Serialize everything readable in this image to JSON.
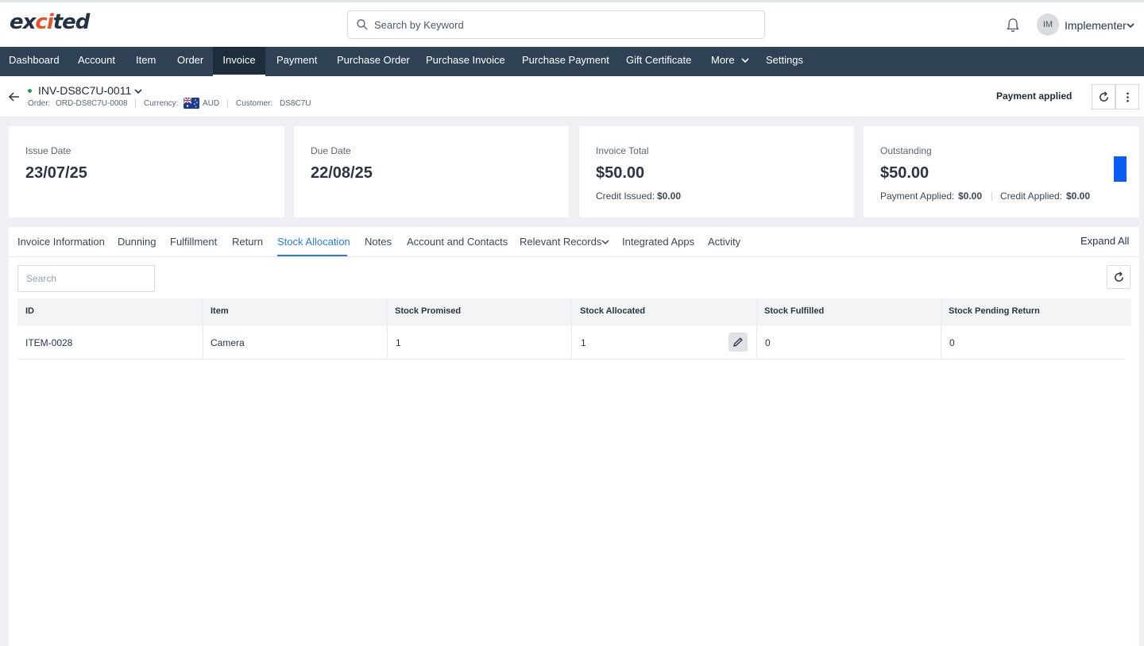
{
  "app": {
    "logo_prefix": "ex",
    "logo_accent": "ci",
    "logo_suffix": "ted"
  },
  "search": {
    "placeholder": "Search by Keyword"
  },
  "user": {
    "initials": "IM",
    "name": "Implementer"
  },
  "nav": {
    "items": [
      "Dashboard",
      "Account",
      "Item",
      "Order",
      "Invoice",
      "Payment",
      "Purchase Order",
      "Purchase Invoice",
      "Purchase Payment",
      "Gift Certificate",
      "More",
      "Settings"
    ],
    "active": "Invoice"
  },
  "record": {
    "id": "INV-DS8C7U-0011",
    "order_label": "Order:",
    "order_value": "ORD-DS8C7U-0008",
    "currency_label": "Currency:",
    "currency_value": "AUD",
    "customer_label": "Customer:",
    "customer_value": "DS8C7U",
    "status": "Payment applied"
  },
  "cards": {
    "issue": {
      "label": "Issue Date",
      "value": "23/07/25"
    },
    "due": {
      "label": "Due Date",
      "value": "22/08/25"
    },
    "total": {
      "label": "Invoice Total",
      "value": "$50.00",
      "credit_issued_label": "Credit Issued:",
      "credit_issued_value": "$0.00"
    },
    "outstanding": {
      "label": "Outstanding",
      "value": "$50.00",
      "payment_applied_label": "Payment Applied:",
      "payment_applied_value": "$0.00",
      "credit_applied_label": "Credit Applied:",
      "credit_applied_value": "$0.00"
    }
  },
  "tabs": {
    "items": [
      "Invoice Information",
      "Dunning",
      "Fulfillment",
      "Return",
      "Stock Allocation",
      "Notes",
      "Account and Contacts",
      "Relevant Records",
      "Integrated Apps",
      "Activity"
    ],
    "active": "Stock Allocation",
    "expand_all": "Expand All"
  },
  "filter": {
    "placeholder": "Search"
  },
  "table": {
    "columns": [
      "ID",
      "Item",
      "Stock Promised",
      "Stock Allocated",
      "Stock Fulfilled",
      "Stock Pending Return"
    ],
    "rows": [
      [
        "ITEM-0028",
        "Camera",
        "1",
        "1",
        "0",
        "0"
      ]
    ]
  },
  "colors": {
    "nav_bg": "#2f4255",
    "nav_active_bg": "#1e2d3b",
    "accent": "#2d7bd6",
    "logo_accent": "#e8522a",
    "status_dot": "#1f9d55",
    "blue_bar": "#0b5cf0"
  }
}
